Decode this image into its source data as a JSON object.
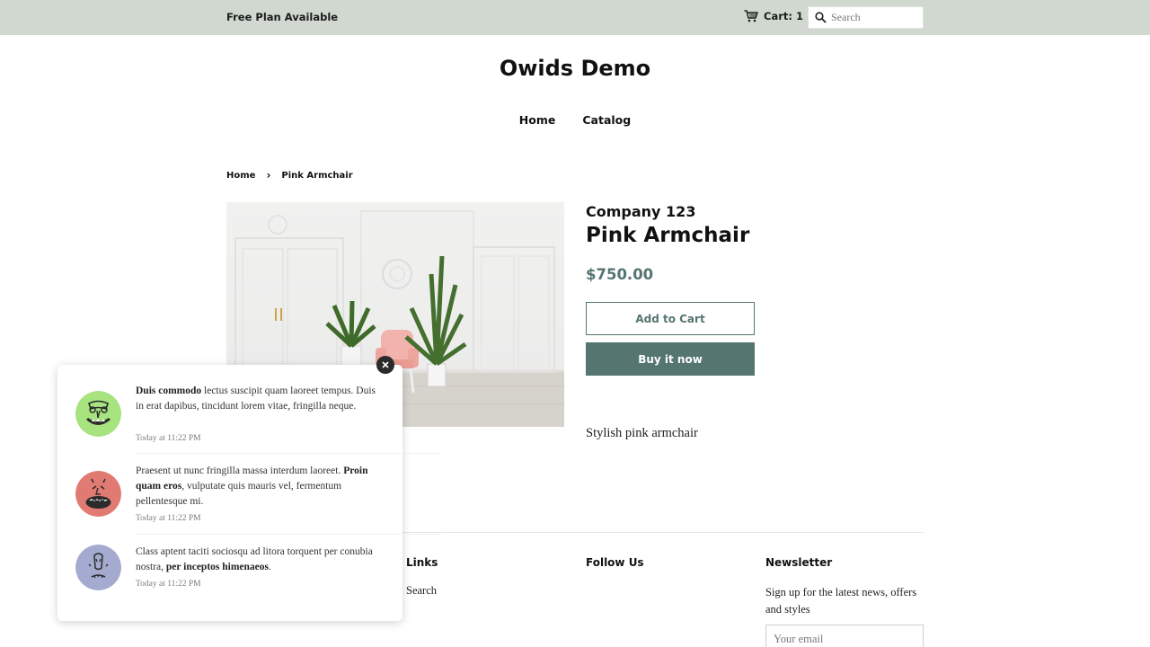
{
  "topbar": {
    "promo_text": "Free Plan Available",
    "cart_label": "Cart: 1",
    "search_placeholder": "Search"
  },
  "header": {
    "site_title": "Owids Demo",
    "nav": [
      {
        "label": "Home"
      },
      {
        "label": "Catalog"
      }
    ]
  },
  "breadcrumb": {
    "home": "Home",
    "separator": "›",
    "current": "Pink Armchair"
  },
  "product": {
    "vendor": "Company 123",
    "title": "Pink Armchair",
    "price": "$750.00",
    "add_to_cart_label": "Add to Cart",
    "buy_now_label": "Buy it now",
    "description": "Stylish pink armchair",
    "image_alt": "Pink armchair in a white room with potted palms"
  },
  "footer": {
    "links_heading": "Links",
    "links": [
      {
        "label": "Search"
      }
    ],
    "follow_heading": "Follow Us",
    "newsletter_heading": "Newsletter",
    "newsletter_text": "Sign up for the latest news, offers and styles",
    "email_placeholder": "Your email"
  },
  "notifications": [
    {
      "bold_lead": "Duis commodo",
      "text_after": " lectus suscipit quam laoreet tempus. Duis in erat dapibus, tincidunt lorem vitae, fringilla neque.",
      "time": "Today at 11:22 PM",
      "avatar_color": "#a7e37f",
      "avatar_icon": "green-monster-face"
    },
    {
      "text_before": "Praesent ut nunc fringilla massa interdum laoreet. ",
      "bold": "Proin quam eros",
      "text_after": ", vulputate quis mauris vel, fermentum pellentesque mi.",
      "time": "Today at 11:22 PM",
      "avatar_color": "#e07a72",
      "avatar_icon": "red-monster-face"
    },
    {
      "text_before": "Class aptent taciti sociosqu ad litora torquent per conubia nostra, ",
      "bold": "per inceptos himenaeos",
      "text_after": ".",
      "time": "Today at 11:22 PM",
      "avatar_color": "#a5abd0",
      "avatar_icon": "blue-monster-face"
    }
  ],
  "colors": {
    "topbar_bg": "#d0d8d0",
    "accent": "#557571",
    "text": "#111111"
  }
}
